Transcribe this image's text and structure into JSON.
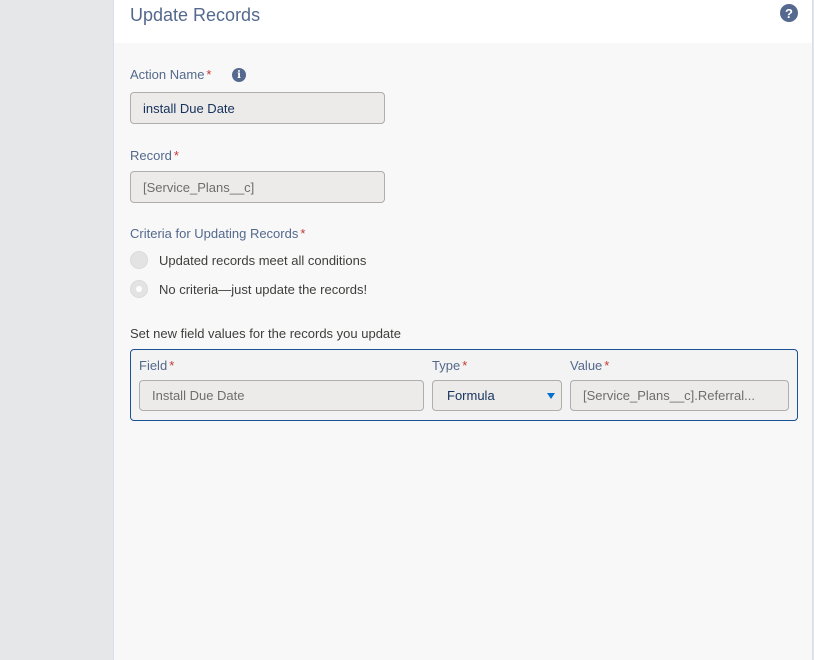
{
  "panel": {
    "title": "Update Records"
  },
  "action_name": {
    "label": "Action Name",
    "required": "*",
    "value": "install Due Date"
  },
  "record": {
    "label": "Record",
    "required": "*",
    "value": "[Service_Plans__c]"
  },
  "criteria": {
    "label": "Criteria for Updating Records",
    "required": "*",
    "options": [
      {
        "label": "Updated records meet all conditions",
        "selected": false
      },
      {
        "label": "No criteria—just update the records!",
        "selected": true
      }
    ]
  },
  "field_values": {
    "section_label": "Set new field values for the records you update",
    "field_label": "Field",
    "type_label": "Type",
    "value_label": "Value",
    "required": "*",
    "row": {
      "field": "Install Due Date",
      "type": "Formula",
      "value": "[Service_Plans__c].Referral..."
    }
  },
  "icons": {
    "help": "help-icon",
    "info": "info-icon"
  },
  "colors": {
    "label": "#54698d",
    "required": "#c23934",
    "focus_border": "#1b5297",
    "select_caret": "#0070d2"
  }
}
